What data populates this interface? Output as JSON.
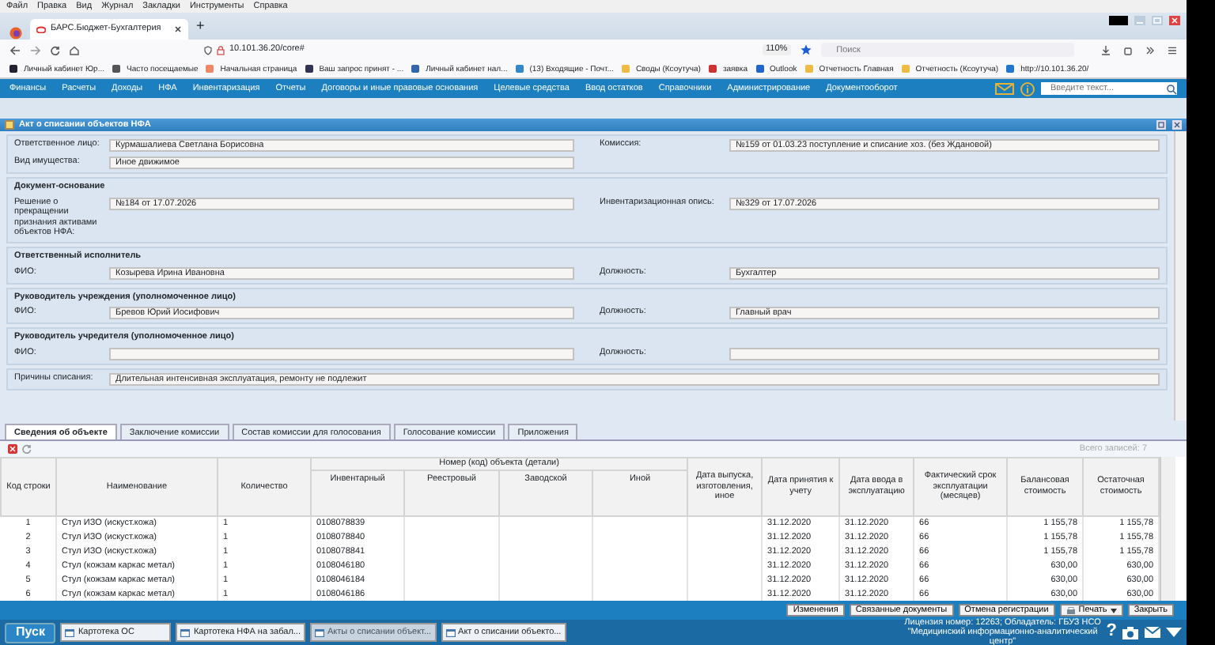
{
  "browser_menu": [
    "Файл",
    "Правка",
    "Вид",
    "Журнал",
    "Закладки",
    "Инструменты",
    "Справка"
  ],
  "browser_tabs": [
    {
      "title": "БАРС.Бюджет-Бухгалтерия",
      "selected": true
    }
  ],
  "new_tab": "+",
  "address": "10.101.36.20/core#",
  "zoom": "110%",
  "search": {
    "placeholder": "Поиск"
  },
  "bookmarks": [
    "Личный кабинет Юр...",
    "Часто посещаемые",
    "Начальная страница",
    "Ваш запрос принят - ...",
    "Личный кабинет нал...",
    "(13) Входящие - Почт...",
    "Своды (Ксоутуча)",
    "заявка",
    "Outlook",
    "Отчетность Главная",
    "Отчетность (Ксоутуча)",
    "http://10.101.36.20/"
  ],
  "app_menu": [
    "Финансы",
    "Расчеты",
    "Доходы",
    "НФА",
    "Инвентаризация",
    "Отчеты",
    "Договоры и иные правовые основания",
    "Целевые средства",
    "Ввод остатков",
    "Справочники",
    "Администрирование",
    "Документооборот"
  ],
  "app_search": {
    "placeholder": "Введите текст..."
  },
  "window": {
    "title": "Акт о списании объектов НФА"
  },
  "form_sections": [
    {
      "rows": [
        [
          {
            "kind": "half",
            "label": "Ответственное лицо:",
            "value": "Курмашалиева Светлана Борисовна"
          },
          {
            "kind": "half",
            "label": "Комиссия:",
            "value": "№159 от 01.03.23 поступление и списание хоз. (без Ждановой)"
          }
        ],
        [
          {
            "kind": "half",
            "label": "Вид имущества:",
            "value": "Иное движимое"
          }
        ]
      ]
    },
    {
      "title": "Документ-основание",
      "rows": [
        [
          {
            "kind": "half",
            "label": "Решение о прекращении признания активами объектов НФА:",
            "value": "№184 от 17.07.2026"
          },
          {
            "kind": "half",
            "label": "Инвентаризационная опись:",
            "value": "№329 от 17.07.2026"
          }
        ]
      ]
    },
    {
      "title": "Ответственный исполнитель",
      "rows": [
        [
          {
            "kind": "half",
            "label": "ФИО:",
            "value": "Козырева Ирина Ивановна"
          },
          {
            "kind": "half",
            "label": "Должность:",
            "value": "Бухгалтер"
          }
        ]
      ]
    },
    {
      "title": "Руководитель учреждения (уполномоченное лицо)",
      "rows": [
        [
          {
            "kind": "half",
            "label": "ФИО:",
            "value": "Бревов Юрий Иосифович"
          },
          {
            "kind": "half",
            "label": "Должность:",
            "value": "Главный врач"
          }
        ]
      ]
    },
    {
      "title": "Руководитель учредителя (уполномоченное лицо)",
      "rows": [
        [
          {
            "kind": "half",
            "label": "ФИО:"
          },
          {
            "kind": "half",
            "label": "Должность:"
          }
        ]
      ]
    },
    {
      "rows": [
        [
          {
            "kind": "wide",
            "label": "Причины списания:",
            "value": "Длительная интенсивная эксплуатация, ремонту не подлежит"
          }
        ]
      ]
    }
  ],
  "tabs": [
    {
      "label": "Сведения об объекте",
      "selected": true
    },
    {
      "label": "Заключение комиссии",
      "selected": false
    },
    {
      "label": "Состав комиссии для голосования",
      "selected": false
    },
    {
      "label": "Голосование комиссии",
      "selected": false
    },
    {
      "label": "Приложения",
      "selected": false
    }
  ],
  "table": {
    "total": "Всего записей: 7",
    "group_header": "Номер (код) объекта (детали)",
    "columns": [
      {
        "label": "Код строки",
        "grouped": false
      },
      {
        "label": "Наименование",
        "grouped": false
      },
      {
        "label": "Количество",
        "grouped": false
      },
      {
        "label": "Инвентарный",
        "grouped": true
      },
      {
        "label": "Реестровый",
        "grouped": true
      },
      {
        "label": "Заводской",
        "grouped": true
      },
      {
        "label": "Иной",
        "grouped": true
      },
      {
        "label": "Дата выпуска, изготовления, иное",
        "grouped": false
      },
      {
        "label": "Дата принятия к учету",
        "grouped": false
      },
      {
        "label": "Дата ввода в эксплуатацию",
        "grouped": false
      },
      {
        "label": "Фактический срок эксплуатации (месяцев)",
        "grouped": false
      },
      {
        "label": "Балансовая стоимость",
        "grouped": false
      },
      {
        "label": "Остаточная стоимость",
        "grouped": false
      }
    ],
    "rows": [
      [
        "1",
        "Стул ИЗО (искуст.кожа)",
        "1",
        "0108078839",
        "",
        "",
        "",
        "",
        "31.12.2020",
        "31.12.2020",
        "66",
        "1 155,78",
        "1 155,78"
      ],
      [
        "2",
        "Стул ИЗО (искуст.кожа)",
        "1",
        "0108078840",
        "",
        "",
        "",
        "",
        "31.12.2020",
        "31.12.2020",
        "66",
        "1 155,78",
        "1 155,78"
      ],
      [
        "3",
        "Стул ИЗО (искуст.кожа)",
        "1",
        "0108078841",
        "",
        "",
        "",
        "",
        "31.12.2020",
        "31.12.2020",
        "66",
        "1 155,78",
        "1 155,78"
      ],
      [
        "4",
        "Стул (кожзам каркас метал)",
        "1",
        "0108046180",
        "",
        "",
        "",
        "",
        "31.12.2020",
        "31.12.2020",
        "66",
        "630,00",
        "630,00"
      ],
      [
        "5",
        "Стул (кожзам каркас метал)",
        "1",
        "0108046184",
        "",
        "",
        "",
        "",
        "31.12.2020",
        "31.12.2020",
        "66",
        "630,00",
        "630,00"
      ],
      [
        "6",
        "Стул (кожзам каркас метал)",
        "1",
        "0108046186",
        "",
        "",
        "",
        "",
        "31.12.2020",
        "31.12.2020",
        "66",
        "630,00",
        "630,00"
      ]
    ]
  },
  "footer_buttons": [
    {
      "label": "Изменения",
      "kind": "plain"
    },
    {
      "label": "Связанные документы",
      "kind": "plain"
    },
    {
      "label": "Отмена регистрации",
      "kind": "plain"
    },
    {
      "label": "Печать",
      "kind": "menu"
    },
    {
      "label": "Закрыть",
      "kind": "plain"
    }
  ],
  "taskbar": {
    "start": "Пуск",
    "items": [
      {
        "label": "Картотека ОС",
        "selected": false
      },
      {
        "label": "Картотека НФА на забал...",
        "selected": false
      },
      {
        "label": "Акты о списании объект...",
        "selected": true
      },
      {
        "label": "Акт о списании объекто...",
        "selected": false
      }
    ],
    "license": "Лицензия номер: 12263; Обладатель: ГБУЗ НСО \"Медицинский информационно-аналитический центр\"",
    "help": "?"
  }
}
